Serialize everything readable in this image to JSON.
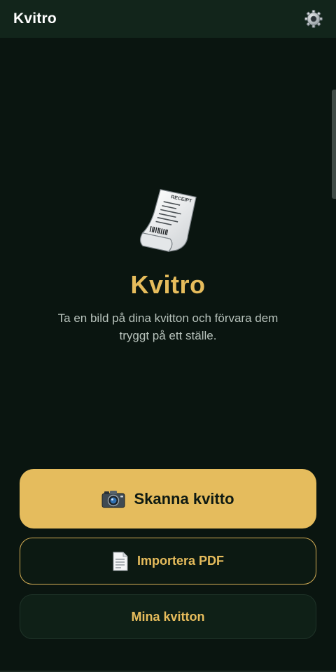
{
  "topbar": {
    "title": "Kvitro",
    "settings_icon": "gear-icon"
  },
  "hero": {
    "illustration_icon": "receipt-icon",
    "receipt_header": "RECEIPT",
    "title": "Kvitro",
    "description": "Ta en bild på dina kvitton och förvara dem tryggt på ett ställe."
  },
  "actions": {
    "scan_label": "Skanna kvitto",
    "scan_icon": "camera-icon",
    "import_label": "Importera PDF",
    "import_icon": "document-icon",
    "receipts_label": "Mina kvitton"
  },
  "colors": {
    "background": "#0a1510",
    "topbar": "#12251b",
    "accent": "#e5bc5d",
    "text_muted": "#b7c2bb"
  }
}
